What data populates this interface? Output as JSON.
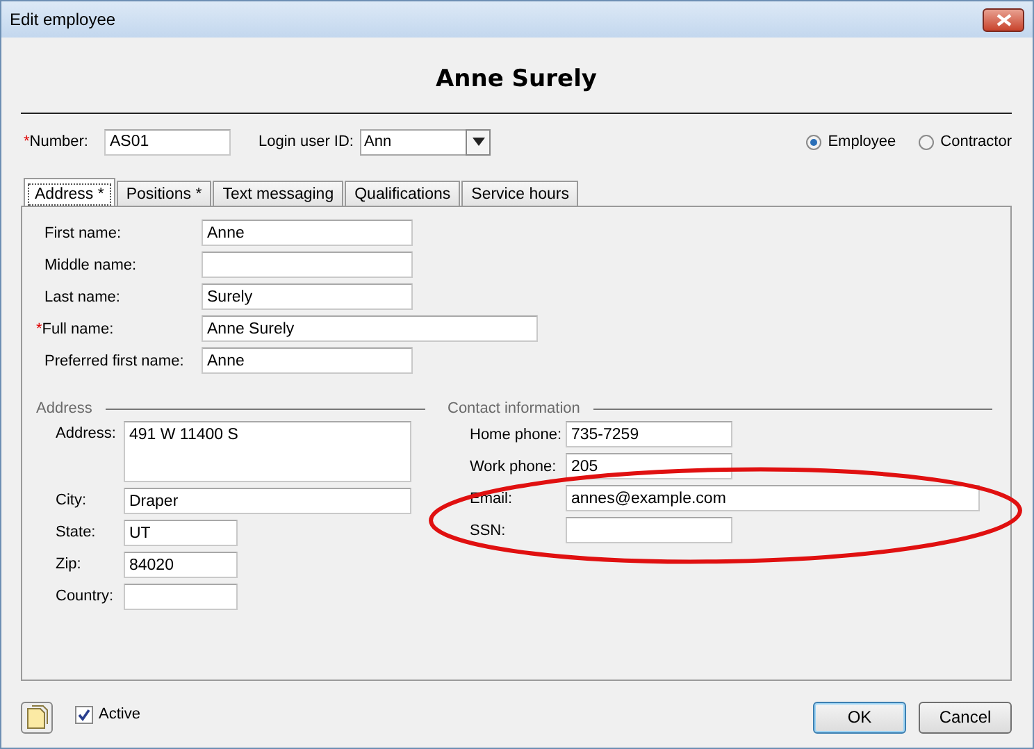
{
  "window": {
    "title": "Edit employee"
  },
  "heading": "Anne Surely",
  "number": {
    "required_mark": "*",
    "label": "Number:",
    "value": "AS01"
  },
  "login_user_id": {
    "label": "Login user ID:",
    "value": "Ann"
  },
  "worker_type": [
    {
      "label": "Employee",
      "selected": true
    },
    {
      "label": "Contractor",
      "selected": false
    }
  ],
  "tabs": [
    {
      "label": "Address *",
      "selected": true
    },
    {
      "label": "Positions *",
      "selected": false
    },
    {
      "label": "Text messaging",
      "selected": false
    },
    {
      "label": "Qualifications",
      "selected": false
    },
    {
      "label": "Service hours",
      "selected": false
    }
  ],
  "name_fields": [
    {
      "label": "First name:",
      "value": "Anne",
      "kind": "narrow"
    },
    {
      "label": "Middle name:",
      "kind": "narrow"
    },
    {
      "label": "Last name:",
      "value": "Surely",
      "kind": "narrow"
    },
    {
      "required_mark": "*",
      "label": "Full name:",
      "value": "Anne Surely",
      "kind": "wide"
    },
    {
      "label": "Preferred first name:",
      "value": "Anne",
      "kind": "narrow"
    }
  ],
  "address_section": {
    "title": "Address",
    "fields": [
      {
        "label": "Address:",
        "value": "491 W 11400 S",
        "kind": "multiline"
      },
      {
        "label": "City:",
        "value": "Draper",
        "kind": "wide"
      },
      {
        "label": "State:",
        "value": "UT",
        "kind": "narrow"
      },
      {
        "label": "Zip:",
        "value": "84020",
        "kind": "narrow"
      },
      {
        "label": "Country:",
        "kind": "narrow"
      }
    ]
  },
  "contact_section": {
    "title": "Contact information",
    "fields": [
      {
        "label": "Home phone:",
        "value": "735-7259",
        "kind": "narrow"
      },
      {
        "label": "Work phone:",
        "value": "205",
        "kind": "narrow"
      },
      {
        "label": "Email:",
        "value": "annes@example.com",
        "kind": "wide"
      },
      {
        "label": "SSN:",
        "kind": "narrow"
      }
    ]
  },
  "active": {
    "label": "Active",
    "checked": true
  },
  "buttons": [
    {
      "label": "OK",
      "default": true
    },
    {
      "label": "Cancel",
      "default": false
    }
  ]
}
